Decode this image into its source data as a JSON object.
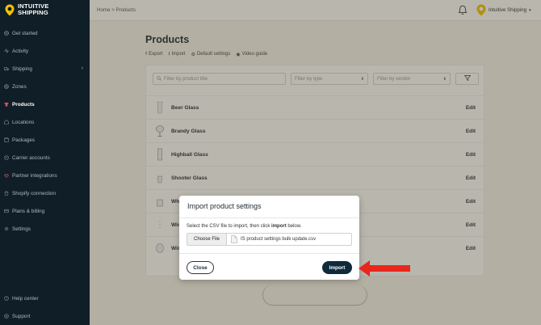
{
  "app": {
    "logo_line1": "INTUITIVE",
    "logo_line2": "SHIPPING"
  },
  "sidebar": {
    "items": [
      {
        "label": "Get started",
        "icon": "plus-circle-icon"
      },
      {
        "label": "Activity",
        "icon": "activity-icon"
      },
      {
        "label": "Shipping",
        "icon": "truck-icon",
        "chevron": "›"
      },
      {
        "label": "Zones",
        "icon": "globe-icon"
      },
      {
        "label": "Products",
        "icon": "tshirt-icon",
        "active": true
      },
      {
        "label": "Locations",
        "icon": "location-icon"
      },
      {
        "label": "Packages",
        "icon": "box-icon"
      },
      {
        "label": "Carrier accounts",
        "icon": "carrier-icon"
      },
      {
        "label": "Partner integrations",
        "icon": "partner-icon"
      },
      {
        "label": "Shopify connection",
        "icon": "shopify-icon"
      },
      {
        "label": "Plans & billing",
        "icon": "billing-icon"
      },
      {
        "label": "Settings",
        "icon": "gear-icon"
      }
    ],
    "bottom": [
      {
        "label": "Help center",
        "icon": "help-icon"
      },
      {
        "label": "Support",
        "icon": "support-icon"
      }
    ]
  },
  "topbar": {
    "breadcrumb": "Home > Products",
    "account_name": "Intuitive Shipping",
    "caret": "▾"
  },
  "page": {
    "title": "Products",
    "actions": {
      "export": "Export",
      "import": "Import",
      "default_settings": "Default settings",
      "video_guide": "Video guide"
    }
  },
  "filters": {
    "search_placeholder": "Filter by product title",
    "type_placeholder": "Filter by type",
    "vendor_placeholder": "Filter by vendor",
    "caret": "⬍"
  },
  "products": [
    {
      "name": "Beer Glass",
      "edit": "Edit"
    },
    {
      "name": "Brandy Glass",
      "edit": "Edit"
    },
    {
      "name": "Highball Glass",
      "edit": "Edit"
    },
    {
      "name": "Shooter Glass",
      "edit": "Edit"
    },
    {
      "name": "Wh",
      "edit": "Edit"
    },
    {
      "name": "Wir",
      "edit": "Edit"
    },
    {
      "name": "Wir",
      "edit": "Edit"
    }
  ],
  "modal": {
    "title": "Import product settings",
    "instruction_pre": "Select the CSV file to import, then click ",
    "instruction_bold": "import",
    "instruction_post": " below.",
    "choose_file": "Choose File",
    "file_name": "IS product settings bulk update.csv",
    "close_label": "Close",
    "import_label": "Import"
  },
  "colors": {
    "sidebar_bg": "#0f1e27",
    "accent_yellow": "#f2c200",
    "import_button": "#0f2a3a",
    "arrow_red": "#e8261c"
  }
}
